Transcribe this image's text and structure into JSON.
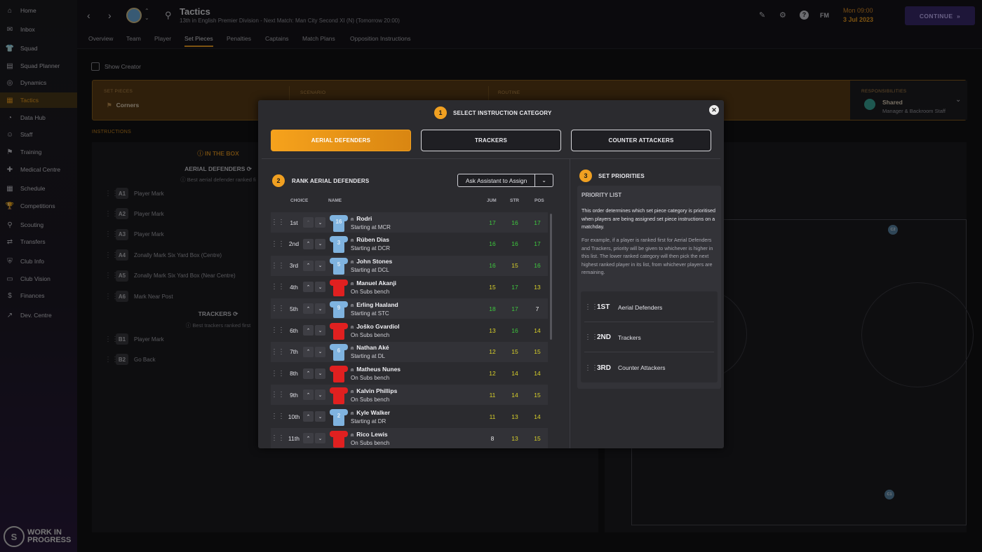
{
  "sidebar": {
    "items": [
      {
        "label": "Home",
        "icon": "⌂"
      },
      {
        "label": "Inbox",
        "icon": "✉"
      },
      {
        "label": "Squad",
        "icon": "👕"
      },
      {
        "label": "Squad Planner",
        "icon": "▤"
      },
      {
        "label": "Dynamics",
        "icon": "◎"
      },
      {
        "label": "Tactics",
        "icon": "▦"
      },
      {
        "label": "Data Hub",
        "icon": "◔"
      },
      {
        "label": "Staff",
        "icon": "☺"
      },
      {
        "label": "Training",
        "icon": "⚑"
      },
      {
        "label": "Medical Centre",
        "icon": "✚"
      },
      {
        "label": "Schedule",
        "icon": "▦"
      },
      {
        "label": "Competitions",
        "icon": "🏆"
      },
      {
        "label": "Scouting",
        "icon": "⚲"
      },
      {
        "label": "Transfers",
        "icon": "⇄"
      },
      {
        "label": "Club Info",
        "icon": "⛨"
      },
      {
        "label": "Club Vision",
        "icon": "▭"
      },
      {
        "label": "Finances",
        "icon": "$"
      },
      {
        "label": "Dev. Centre",
        "icon": "↗"
      }
    ],
    "active_index": 5,
    "footer": {
      "line1": "WORK IN",
      "line2": "PROGRESS"
    }
  },
  "topbar": {
    "title": "Tactics",
    "subtitle": "13th in English Premier Division - Next Match: Man City Second XI (N) (Tomorrow 20:00)",
    "fm_label": "FM",
    "date_line1": "Mon 09:00",
    "date_line2": "3 Jul 2023",
    "continue_label": "CONTINUE"
  },
  "tabs": [
    "Overview",
    "Team",
    "Player",
    "Set Pieces",
    "Penalties",
    "Captains",
    "Match Plans",
    "Opposition Instructions"
  ],
  "active_tab": 3,
  "show_creator_label": "Show Creator",
  "set_bar": {
    "set_pieces_label": "SET PIECES",
    "set_pieces_value": "Corners",
    "scenario_label": "SCENARIO",
    "routine_label": "ROUTINE",
    "responsibilities_label": "RESPONSIBILITIES",
    "responsibilities_value": "Shared",
    "responsibilities_sub": "Manager & Backroom Staff"
  },
  "instructions_label": "INSTRUCTIONS",
  "in_the_box": {
    "heading": "IN THE BOX",
    "aerial_heading": "AERIAL DEFENDERS",
    "aerial_sub": "Best aerial defender ranked fi",
    "aerial_rows": [
      {
        "code": "A1",
        "label": "Player Mark"
      },
      {
        "code": "A2",
        "label": "Player Mark"
      },
      {
        "code": "A3",
        "label": "Player Mark"
      },
      {
        "code": "A4",
        "label": "Zonally Mark Six Yard Box (Centre)"
      },
      {
        "code": "A5",
        "label": "Zonally Mark Six Yard Box (Near Centre)"
      },
      {
        "code": "A6",
        "label": "Mark Near Post"
      }
    ],
    "trackers_heading": "TRACKERS",
    "trackers_sub": "Best trackers ranked first",
    "tracker_rows": [
      {
        "code": "B1",
        "label": "Player Mark"
      },
      {
        "code": "B2",
        "label": "Go Back"
      }
    ]
  },
  "pitch_markers": {
    "c2": "C2",
    "c1": "C1"
  },
  "modal": {
    "step1": "1",
    "step1_title": "SELECT INSTRUCTION CATEGORY",
    "categories": [
      "AERIAL DEFENDERS",
      "TRACKERS",
      "COUNTER ATTACKERS"
    ],
    "active_category": 0,
    "step2": "2",
    "step2_title": "RANK AERIAL DEFENDERS",
    "assist_label": "Ask Assistant to Assign",
    "columns": {
      "choice": "CHOICE",
      "name": "NAME",
      "jum": "JUM",
      "str": "STR",
      "pos": "POS"
    },
    "players": [
      {
        "choice": "1st",
        "name": "Rodri",
        "status": "Starting at MCR",
        "kit": "home",
        "number": "16",
        "jum": "17",
        "str": "16",
        "pos": "17"
      },
      {
        "choice": "2nd",
        "name": "Rúben Dias",
        "status": "Starting at DCR",
        "kit": "home",
        "number": "3",
        "jum": "16",
        "str": "16",
        "pos": "17"
      },
      {
        "choice": "3rd",
        "name": "John Stones",
        "status": "Starting at DCL",
        "kit": "home",
        "number": "5",
        "jum": "16",
        "str": "15",
        "pos": "16"
      },
      {
        "choice": "4th",
        "name": "Manuel Akanji",
        "status": "On Subs bench",
        "kit": "red",
        "number": "",
        "jum": "15",
        "str": "17",
        "pos": "13"
      },
      {
        "choice": "5th",
        "name": "Erling Haaland",
        "status": "Starting at STC",
        "kit": "home",
        "number": "9",
        "jum": "18",
        "str": "17",
        "pos": "7"
      },
      {
        "choice": "6th",
        "name": "Joško Gvardiol",
        "status": "On Subs bench",
        "kit": "red",
        "number": "",
        "jum": "13",
        "str": "16",
        "pos": "14"
      },
      {
        "choice": "7th",
        "name": "Nathan Aké",
        "status": "Starting at DL",
        "kit": "home",
        "number": "6",
        "jum": "12",
        "str": "15",
        "pos": "15"
      },
      {
        "choice": "8th",
        "name": "Matheus Nunes",
        "status": "On Subs bench",
        "kit": "red",
        "number": "",
        "jum": "12",
        "str": "14",
        "pos": "14"
      },
      {
        "choice": "9th",
        "name": "Kalvin Phillips",
        "status": "On Subs bench",
        "kit": "red",
        "number": "",
        "jum": "11",
        "str": "14",
        "pos": "15"
      },
      {
        "choice": "10th",
        "name": "Kyle Walker",
        "status": "Starting at DR",
        "kit": "home",
        "number": "2",
        "jum": "11",
        "str": "13",
        "pos": "14"
      },
      {
        "choice": "11th",
        "name": "Rico Lewis",
        "status": "On Subs bench",
        "kit": "red",
        "number": "",
        "jum": "8",
        "str": "13",
        "pos": "15"
      }
    ],
    "step3": "3",
    "step3_title": "SET PRIORITIES",
    "priority_heading": "PRIORITY LIST",
    "priority_text1": "This order determines which set piece category is prioritised when players are being assigned set piece instructions on a matchday.",
    "priority_text2": "For example, if a player is ranked first for Aerial Defenders and Trackers, priority will be given to whichever is higher in this list. The lower ranked category will then pick the next highest ranked player in its list, from whichever players are remaining.",
    "priorities": [
      {
        "rank": "1ST",
        "label": "Aerial Defenders"
      },
      {
        "rank": "2ND",
        "label": "Trackers"
      },
      {
        "rank": "3RD",
        "label": "Counter Attackers"
      }
    ]
  },
  "colors": {
    "accent": "#f0a021",
    "attr_green": "#3ec83e",
    "attr_yellow": "#d8d02a",
    "attr_white": "#e8e8ea",
    "home_kit": "#7fb3df",
    "red_kit": "#e02020"
  }
}
